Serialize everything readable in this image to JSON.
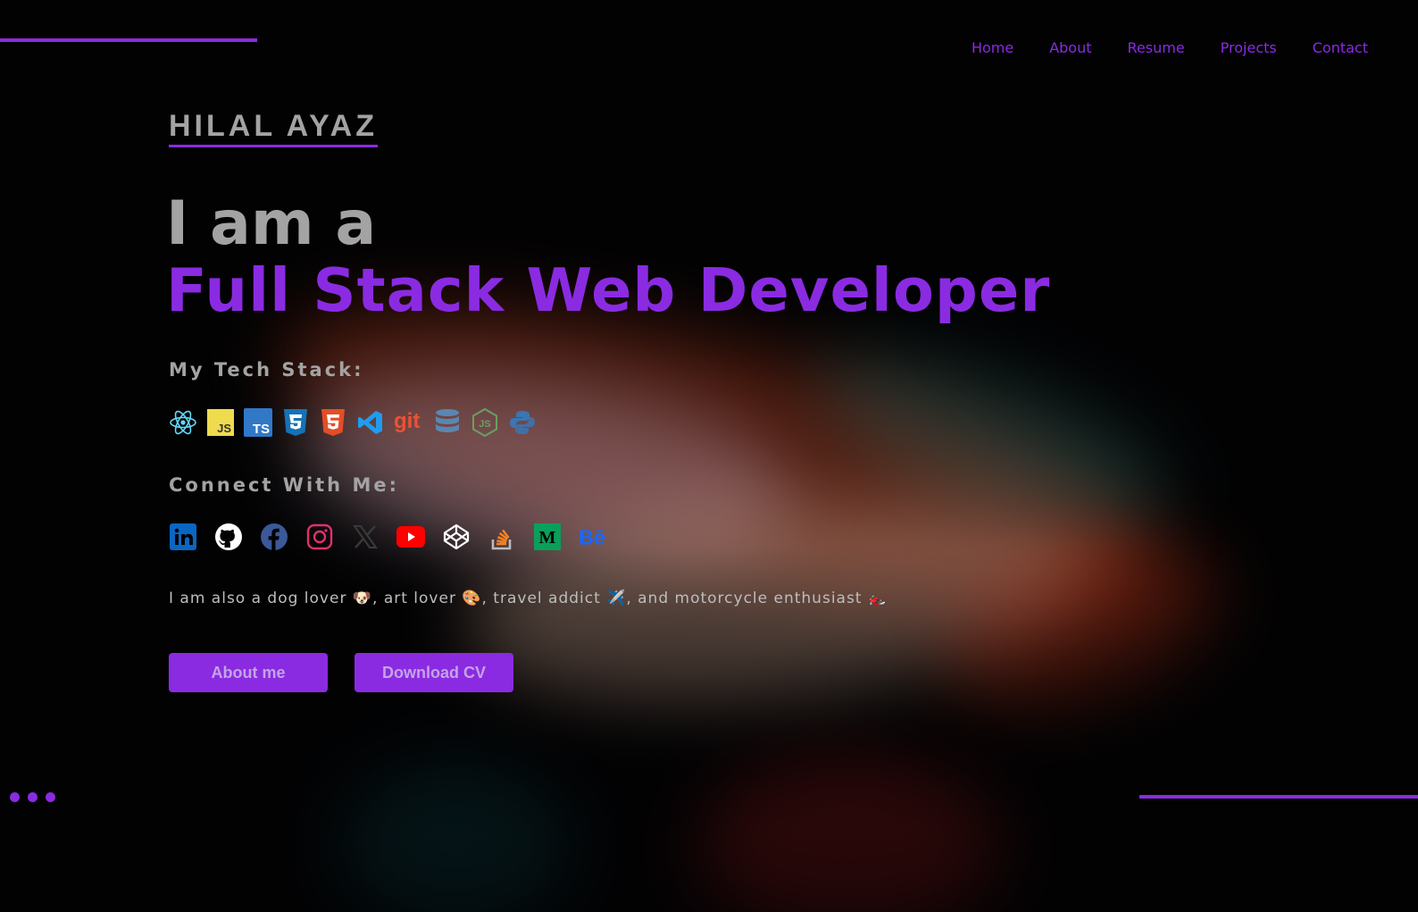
{
  "nav": {
    "items": [
      "Home",
      "About",
      "Resume",
      "Projects",
      "Contact"
    ]
  },
  "hero": {
    "brand": "HILAL AYAZ",
    "lead": "I am a",
    "role": "Full Stack Web Developer",
    "tech_heading": "My Tech Stack:",
    "connect_heading": "Connect With Me:",
    "bio": "I am also a dog lover 🐶, art lover 🎨, travel addict ✈️, and motorcycle enthusiast 🏍️",
    "about_button": "About me",
    "cv_button": "Download CV"
  },
  "tech_icons": [
    "react-icon",
    "javascript-icon",
    "typescript-icon",
    "css3-icon",
    "html5-icon",
    "vscode-icon",
    "git-icon",
    "database-icon",
    "nodejs-icon",
    "python-icon"
  ],
  "social_icons": [
    "linkedin-icon",
    "github-icon",
    "facebook-icon",
    "instagram-icon",
    "x-icon",
    "youtube-icon",
    "codepen-icon",
    "stackoverflow-icon",
    "medium-icon",
    "behance-icon"
  ],
  "colors": {
    "accent": "#8a2be2",
    "text": "#a3a3a3",
    "background": "#020203"
  }
}
